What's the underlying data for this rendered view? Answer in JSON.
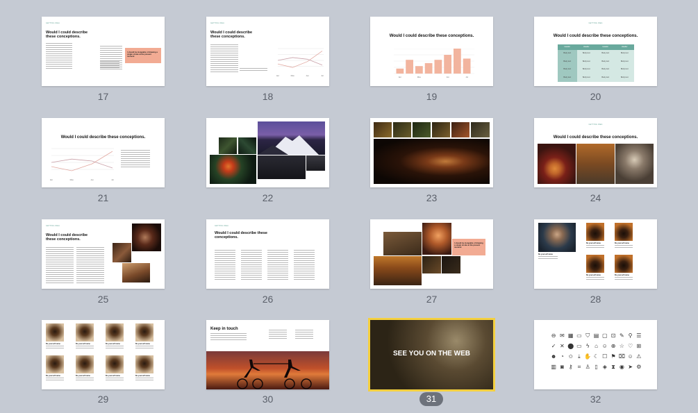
{
  "slide_title": "Would I could describe these conceptions.",
  "tag_label": "GETTING IDEA",
  "pink_quote": "I should be incapable of drawing a single stroke at the present moment",
  "table_headers": [
    "Header",
    "Header",
    "Header",
    "Header"
  ],
  "table_cell": "Body text",
  "chart_months": [
    "Apr",
    "May",
    "Jun",
    "Jul"
  ],
  "person_caption": "Be yourself name",
  "keep_in_touch": "Keep in touch",
  "see_you": "SEE YOU ON THE WEB",
  "slide_numbers": [
    "17",
    "18",
    "19",
    "20",
    "21",
    "22",
    "23",
    "24",
    "25",
    "26",
    "27",
    "28",
    "29",
    "30",
    "31",
    "32"
  ],
  "selected_slide": "31",
  "chart_data": [
    {
      "type": "line",
      "slide": "18",
      "x": [
        "Apr",
        "May",
        "Jun",
        "Jul"
      ],
      "series": [
        {
          "values": [
            0.35,
            0.2,
            0.45,
            0.9
          ]
        },
        {
          "values": [
            0.5,
            0.62,
            0.55,
            0.3
          ]
        }
      ]
    },
    {
      "type": "bar",
      "slide": "19",
      "categories": [
        "Apr",
        "",
        "May",
        "",
        "",
        "Jun",
        "",
        "Jul"
      ],
      "values": [
        0.2,
        0.55,
        0.3,
        0.42,
        0.55,
        0.75,
        1.0,
        0.6
      ]
    },
    {
      "type": "line",
      "slide": "21",
      "x": [
        "Apr",
        "May",
        "Jun",
        "Jul"
      ],
      "series": [
        {
          "values": [
            0.35,
            0.2,
            0.45,
            0.9
          ]
        },
        {
          "values": [
            0.5,
            0.62,
            0.55,
            0.3
          ]
        }
      ]
    }
  ]
}
